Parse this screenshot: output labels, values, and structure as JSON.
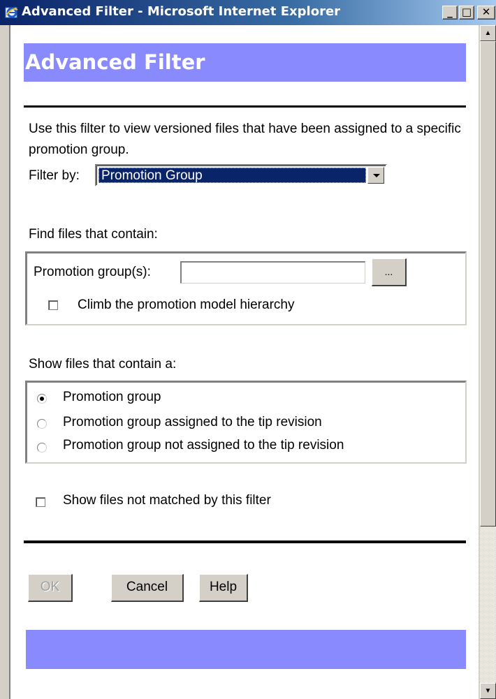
{
  "window": {
    "title": "Advanced Filter - Microsoft Internet Explorer",
    "minimize": "_",
    "maximize": "□",
    "close": "✕"
  },
  "page": {
    "heading": "Advanced Filter",
    "description": "Use this filter to view versioned files that have been assigned to a specific promotion group.",
    "filter_by_label": "Filter by:",
    "filter_by_value": "Promotion Group",
    "find_label": "Find files that contain:",
    "promotion_groups_label": "Promotion group(s):",
    "promotion_groups_value": "",
    "browse_button": "...",
    "climb_label": "Climb the promotion model hierarchy",
    "climb_checked": false,
    "show_label": "Show files that contain a:",
    "options": [
      {
        "label": "Promotion group",
        "checked": true
      },
      {
        "label": "Promotion group assigned to the tip revision",
        "checked": false
      },
      {
        "label": "Promotion group not assigned to the tip revision",
        "checked": false
      }
    ],
    "not_matched_label": "Show files not matched by this filter",
    "not_matched_checked": false,
    "ok_button": "OK",
    "cancel_button": "Cancel",
    "help_button": "Help"
  },
  "colors": {
    "header_bar": "#8a8aff",
    "selection": "#0a246a",
    "window_face": "#d4d0c8"
  },
  "icons": {
    "title": "internet-explorer-icon",
    "scroll_up": "arrow-up-icon",
    "scroll_down": "arrow-down-icon"
  }
}
